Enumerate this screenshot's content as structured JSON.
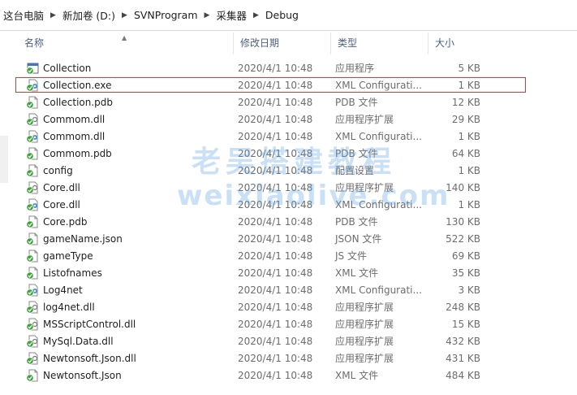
{
  "breadcrumb": [
    "这台电脑",
    "新加卷 (D:)",
    "SVNProgram",
    "采集器",
    "Debug"
  ],
  "columns": {
    "name": "名称",
    "date": "修改日期",
    "type": "类型",
    "size": "大小"
  },
  "files": [
    {
      "name": "Collection",
      "date": "2020/4/1 10:48",
      "type": "应用程序",
      "size": "5 KB",
      "icon": "application-icon"
    },
    {
      "name": "Collection.exe",
      "date": "2020/4/1 10:48",
      "type": "XML Configurati...",
      "size": "1 KB",
      "icon": "config-file-icon"
    },
    {
      "name": "Collection.pdb",
      "date": "2020/4/1 10:48",
      "type": "PDB 文件",
      "size": "12 KB",
      "icon": "file-icon"
    },
    {
      "name": "Commom.dll",
      "date": "2020/4/1 10:48",
      "type": "应用程序扩展",
      "size": "29 KB",
      "icon": "dll-file-icon"
    },
    {
      "name": "Commom.dll",
      "date": "2020/4/1 10:48",
      "type": "XML Configurati...",
      "size": "1 KB",
      "icon": "config-file-icon"
    },
    {
      "name": "Commom.pdb",
      "date": "2020/4/1 10:48",
      "type": "PDB 文件",
      "size": "64 KB",
      "icon": "file-icon"
    },
    {
      "name": "config",
      "date": "2020/4/1 10:48",
      "type": "配置设置",
      "size": "1 KB",
      "icon": "file-icon"
    },
    {
      "name": "Core.dll",
      "date": "2020/4/1 10:48",
      "type": "应用程序扩展",
      "size": "140 KB",
      "icon": "dll-file-icon"
    },
    {
      "name": "Core.dll",
      "date": "2020/4/1 10:48",
      "type": "XML Configurati...",
      "size": "1 KB",
      "icon": "config-file-icon"
    },
    {
      "name": "Core.pdb",
      "date": "2020/4/1 10:48",
      "type": "PDB 文件",
      "size": "130 KB",
      "icon": "file-icon"
    },
    {
      "name": "gameName.json",
      "date": "2020/4/1 10:48",
      "type": "JSON 文件",
      "size": "522 KB",
      "icon": "file-icon"
    },
    {
      "name": "gameType",
      "date": "2020/4/1 10:48",
      "type": "JS 文件",
      "size": "69 KB",
      "icon": "file-icon"
    },
    {
      "name": "Listofnames",
      "date": "2020/4/1 10:48",
      "type": "XML 文件",
      "size": "35 KB",
      "icon": "file-icon"
    },
    {
      "name": "Log4net",
      "date": "2020/4/1 10:48",
      "type": "XML Configurati...",
      "size": "3 KB",
      "icon": "config-file-icon"
    },
    {
      "name": "log4net.dll",
      "date": "2020/4/1 10:48",
      "type": "应用程序扩展",
      "size": "248 KB",
      "icon": "dll-file-icon"
    },
    {
      "name": "MSScriptControl.dll",
      "date": "2020/4/1 10:48",
      "type": "应用程序扩展",
      "size": "15 KB",
      "icon": "dll-file-icon"
    },
    {
      "name": "MySql.Data.dll",
      "date": "2020/4/1 10:48",
      "type": "应用程序扩展",
      "size": "432 KB",
      "icon": "dll-file-icon"
    },
    {
      "name": "Newtonsoft.Json.dll",
      "date": "2020/4/1 10:48",
      "type": "应用程序扩展",
      "size": "431 KB",
      "icon": "dll-file-icon"
    },
    {
      "name": "Newtonsoft.Json",
      "date": "2020/4/1 10:48",
      "type": "XML 文件",
      "size": "484 KB",
      "icon": "file-icon"
    }
  ],
  "selected_index": 1,
  "watermark": {
    "line1": "老吴搭建教程",
    "line2": "weixiaolive.com"
  },
  "colors": {
    "selection_border": "#d8393a",
    "header_text": "#4d6082",
    "svn_check": "#3aa335"
  }
}
